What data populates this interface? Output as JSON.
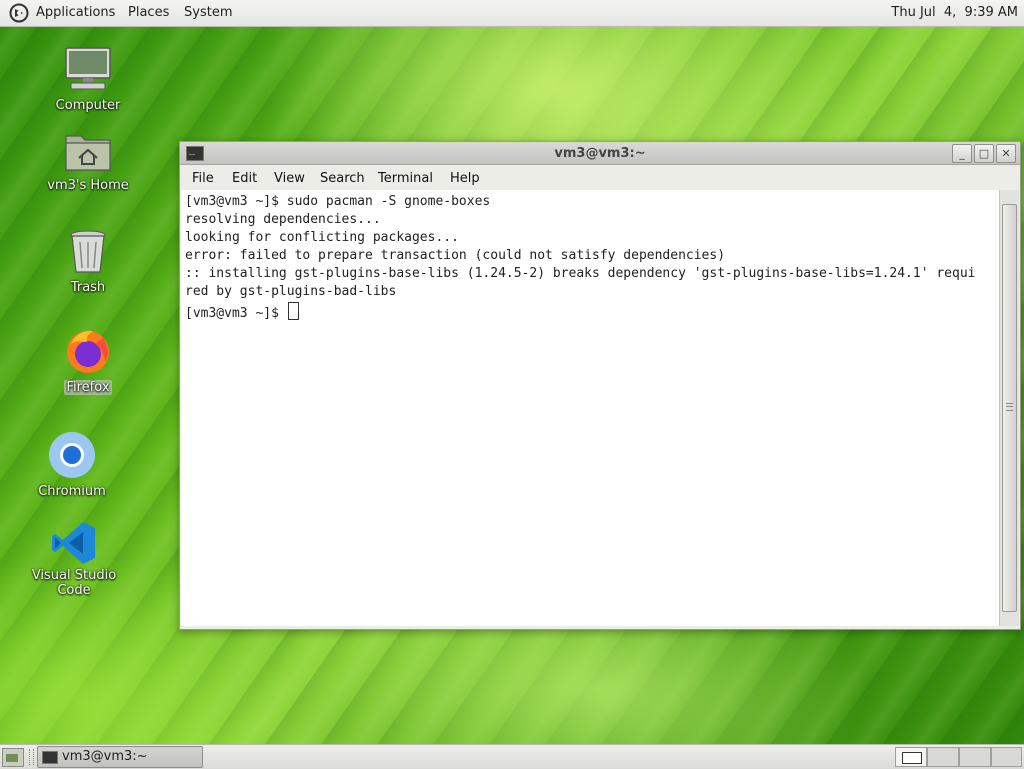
{
  "top_panel": {
    "menus": [
      "Applications",
      "Places",
      "System"
    ],
    "clock": "Thu Jul  4,  9:39 AM"
  },
  "desktop_icons": [
    {
      "label": "Computer",
      "icon": "computer-icon"
    },
    {
      "label": "vm3's Home",
      "icon": "home-folder-icon"
    },
    {
      "label": "Trash",
      "icon": "trash-icon"
    },
    {
      "label": "Firefox",
      "icon": "firefox-icon"
    },
    {
      "label": "Chromium",
      "icon": "chromium-icon"
    },
    {
      "label": "Visual Studio Code",
      "icon": "vscode-icon"
    }
  ],
  "terminal_window": {
    "title": "vm3@vm3:~",
    "menus": [
      "File",
      "Edit",
      "View",
      "Search",
      "Terminal",
      "Help"
    ],
    "lines": [
      "[vm3@vm3 ~]$ sudo pacman -S gnome-boxes",
      "resolving dependencies...",
      "looking for conflicting packages...",
      "error: failed to prepare transaction (could not satisfy dependencies)",
      ":: installing gst-plugins-base-libs (1.24.5-2) breaks dependency 'gst-plugins-base-libs=1.24.1' requi",
      "red by gst-plugins-bad-libs",
      "[vm3@vm3 ~]$ "
    ]
  },
  "bottom_panel": {
    "task_label": "vm3@vm3:~"
  }
}
